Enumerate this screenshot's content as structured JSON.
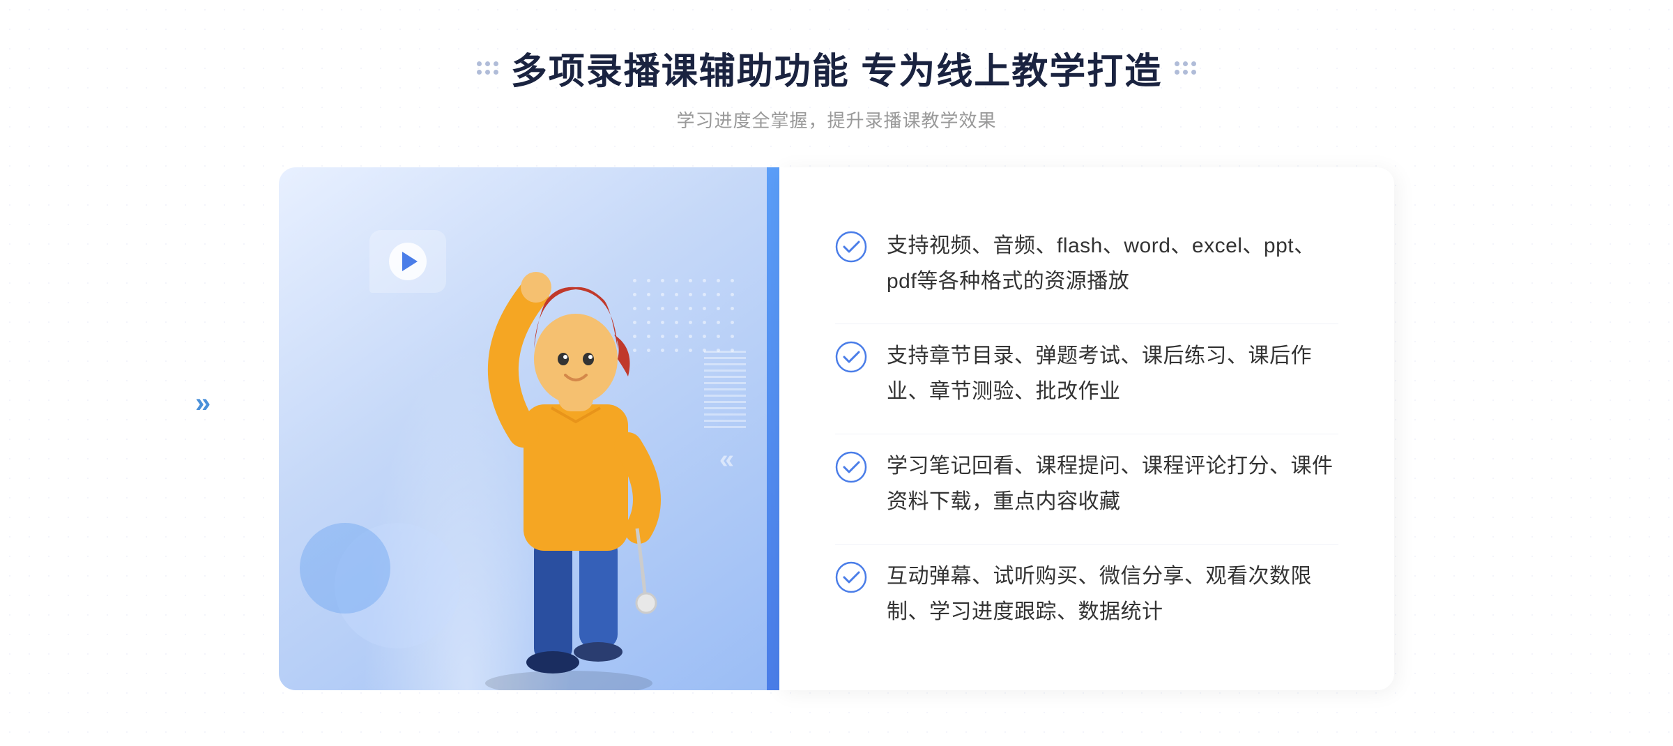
{
  "header": {
    "title": "多项录播课辅助功能 专为线上教学打造",
    "subtitle": "学习进度全掌握，提升录播课教学效果"
  },
  "decoration": {
    "dots_icon": "dots-icon",
    "outer_arrow": "»"
  },
  "features": [
    {
      "id": 1,
      "text": "支持视频、音频、flash、word、excel、ppt、pdf等各种格式的资源播放"
    },
    {
      "id": 2,
      "text": "支持章节目录、弹题考试、课后练习、课后作业、章节测验、批改作业"
    },
    {
      "id": 3,
      "text": "学习笔记回看、课程提问、课程评论打分、课件资料下载，重点内容收藏"
    },
    {
      "id": 4,
      "text": "互动弹幕、试听购买、微信分享、观看次数限制、学习进度跟踪、数据统计"
    }
  ]
}
